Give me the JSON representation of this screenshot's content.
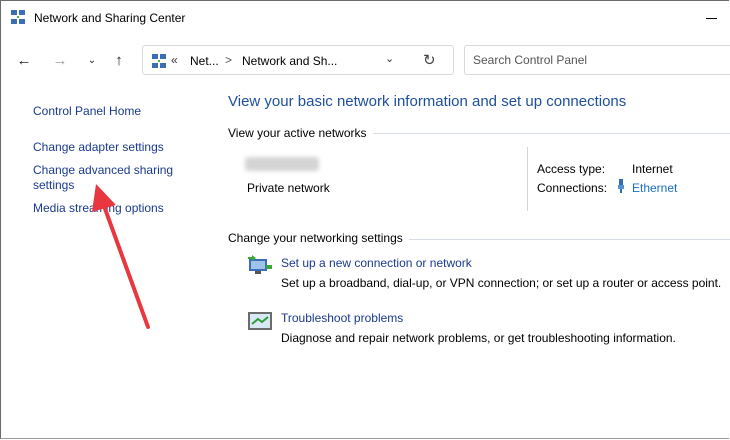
{
  "window": {
    "title": "Network and Sharing Center"
  },
  "navigation": {
    "breadcrumb_prefix": "«",
    "breadcrumb": [
      "Net...",
      "Network and Sh..."
    ],
    "separator": ">",
    "search_placeholder": "Search Control Panel"
  },
  "sidebar": {
    "links": [
      "Control Panel Home",
      "Change adapter settings",
      "Change advanced sharing settings",
      "Media streaming options"
    ]
  },
  "main": {
    "heading": "View your basic network information and set up connections",
    "active_networks_label": "View your active networks",
    "network": {
      "type": "Private network",
      "access_type_label": "Access type:",
      "access_type_value": "Internet",
      "connections_label": "Connections:",
      "connections_value": "Ethernet"
    },
    "change_settings_label": "Change your networking settings",
    "tasks": [
      {
        "title": "Set up a new connection or network",
        "description": "Set up a broadband, dial-up, or VPN connection; or set up a router or access point."
      },
      {
        "title": "Troubleshoot problems",
        "description": "Diagnose and repair network problems, or get troubleshooting information."
      }
    ]
  },
  "colors": {
    "link": "#1a3a8e",
    "heading": "#1e4e9e",
    "annotation_arrow": "#e8373e"
  }
}
